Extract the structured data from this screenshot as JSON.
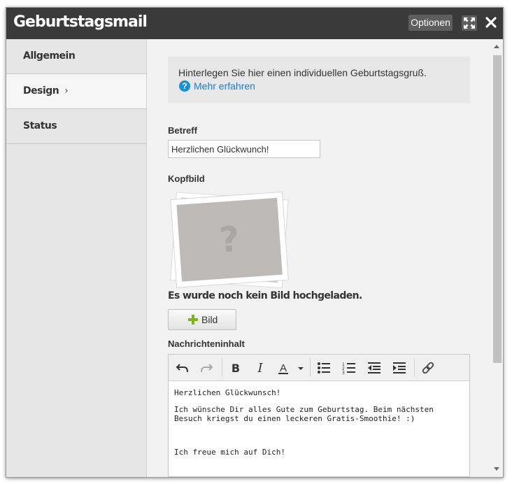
{
  "window": {
    "title": "Geburtstagsmail",
    "options_label": "Optionen"
  },
  "sidebar": {
    "items": [
      {
        "label": "Allgemein",
        "active": false
      },
      {
        "label": "Design",
        "active": true,
        "chevron": "›"
      },
      {
        "label": "Status",
        "active": false
      }
    ]
  },
  "info": {
    "text": "Hinterlegen Sie hier einen individuellen Geburtstagsgruß.",
    "help_icon": "?",
    "link_label": "Mehr erfahren"
  },
  "form": {
    "subject_label": "Betreff",
    "subject_value": "Herzlichen Glückwunch!",
    "header_image_label": "Kopfbild",
    "no_image_text": "Es wurde noch kein Bild hochgeladen.",
    "image_button_label": "Bild",
    "message_label": "Nachrichteninhalt"
  },
  "editor": {
    "toolbar": [
      "undo-icon",
      "redo-icon",
      "bold-icon",
      "italic-icon",
      "font-color-icon",
      "bullet-list-icon",
      "numbered-list-icon",
      "outdent-icon",
      "indent-icon",
      "link-icon"
    ],
    "body": [
      "Herzlichen Glückwunsch!",
      "Ich wünsche Dir alles Gute zum Geburtstag. Beim nächsten Besuch kriegst du einen leckeren Gratis-Smoothie! :)",
      "Ich freue mich auf Dich!"
    ]
  },
  "colors": {
    "titlebar": "#3a3a3a",
    "link": "#1a7ec9",
    "plus_icon": "#7cb518"
  }
}
